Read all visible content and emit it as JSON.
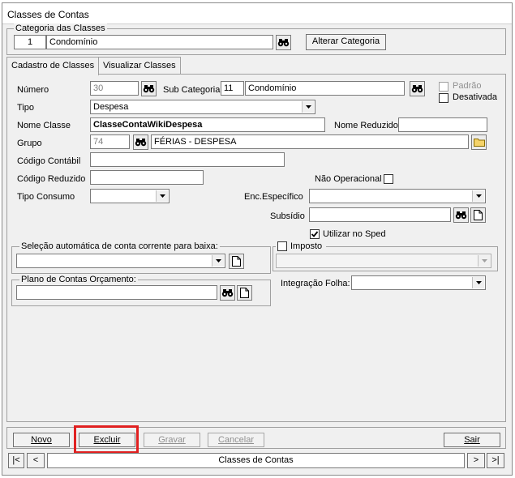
{
  "window": {
    "title": "Classes de Contas"
  },
  "categoria": {
    "legend": "Categoria das Classes",
    "code": "1",
    "name": "Condomínio",
    "alterar_label": "Alterar Categoria"
  },
  "tabs": [
    {
      "label": "Cadastro de Classes",
      "active": true
    },
    {
      "label": "Visualizar Classes",
      "active": false
    }
  ],
  "form": {
    "numero": {
      "label": "Número",
      "value": "30"
    },
    "sub_categoria": {
      "label": "Sub Categoria",
      "code": "11",
      "name": "Condomínio"
    },
    "padrao": {
      "label": "Padrão",
      "checked": false
    },
    "desativada": {
      "label": "Desativada",
      "checked": false
    },
    "tipo": {
      "label": "Tipo",
      "value": "Despesa"
    },
    "nome_classe": {
      "label": "Nome Classe",
      "value": "ClasseContaWikiDespesa"
    },
    "nome_reduzido": {
      "label": "Nome Reduzido",
      "value": ""
    },
    "grupo": {
      "label": "Grupo",
      "code": "74",
      "name": "FÉRIAS - DESPESA"
    },
    "codigo_contabil": {
      "label": "Código Contábil",
      "value": ""
    },
    "codigo_reduzido": {
      "label": "Código Reduzido",
      "value": ""
    },
    "nao_operacional": {
      "label": "Não Operacional",
      "checked": false
    },
    "tipo_consumo": {
      "label": "Tipo Consumo",
      "value": ""
    },
    "enc_especifico": {
      "label": "Enc.Específico",
      "value": ""
    },
    "subsidio": {
      "label": "Subsídio",
      "value": ""
    },
    "utilizar_sped": {
      "label": "Utilizar no Sped",
      "checked": true
    },
    "selecao_auto": {
      "legend": "Seleção automática de conta corrente para baixa:",
      "value": ""
    },
    "imposto": {
      "legend": "Imposto",
      "checked": false,
      "value": ""
    },
    "plano_contas": {
      "legend": "Plano de Contas Orçamento:",
      "value": ""
    },
    "integracao_folha": {
      "label": "Integração Folha:",
      "value": ""
    }
  },
  "buttons": {
    "novo": "Novo",
    "excluir": "Excluir",
    "gravar": "Gravar",
    "cancelar": "Cancelar",
    "sair": "Sair"
  },
  "nav": {
    "first": "|<",
    "prev": "<",
    "label": "Classes de Contas",
    "next": ">",
    "last": ">|"
  },
  "colors": {
    "highlight": "#e02020"
  }
}
